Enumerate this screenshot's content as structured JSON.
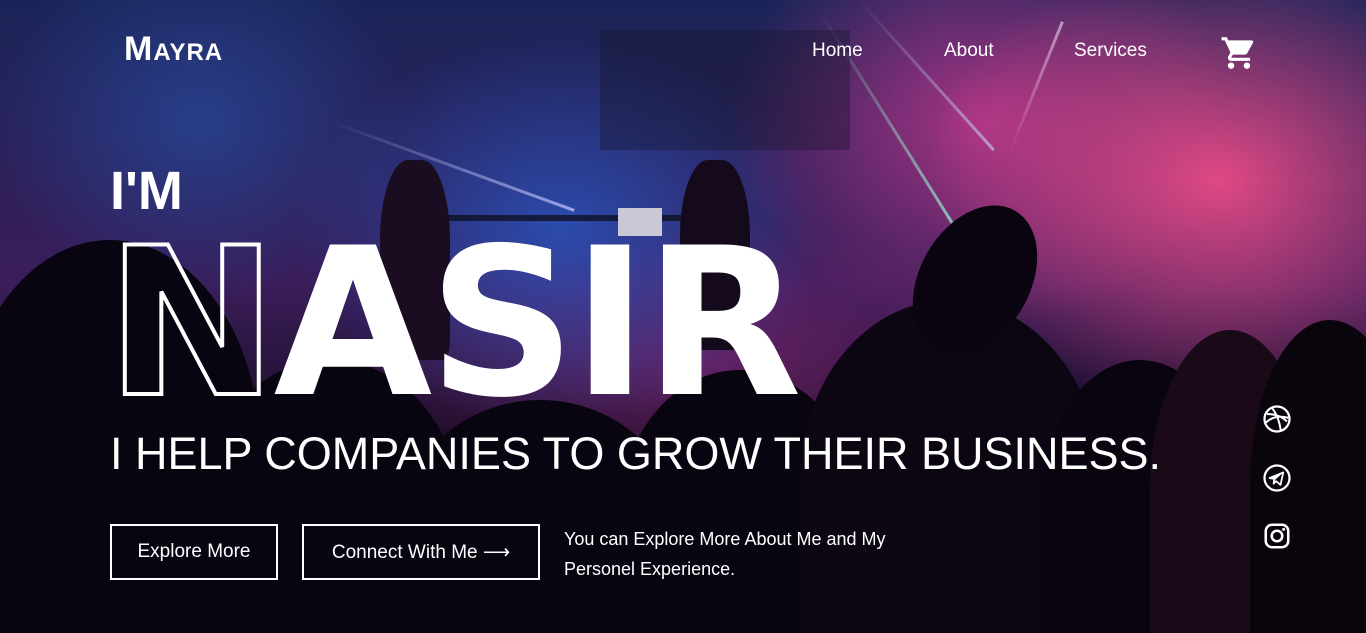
{
  "header": {
    "logo": {
      "first": "M",
      "rest": "AYRA"
    },
    "nav": [
      {
        "label": "Home"
      },
      {
        "label": "About"
      },
      {
        "label": "Services"
      }
    ],
    "cart_icon": "cart-icon"
  },
  "hero": {
    "intro": "I'M",
    "name": {
      "outlined_part": "N",
      "filled_part": "ASIR"
    },
    "tagline": "I HELP COMPANIES TO GROW THEIR BUSINESS.",
    "buttons": {
      "explore": "Explore More",
      "connect": "Connect With Me ⟶"
    },
    "description": "You can Explore More About Me and My Personel Experience."
  },
  "social": [
    {
      "icon": "dribbble-icon"
    },
    {
      "icon": "telegram-icon"
    },
    {
      "icon": "instagram-icon"
    }
  ],
  "colors": {
    "text": "#ffffff",
    "accent_pink": "#ff4f8b",
    "accent_blue": "#2a4fb8"
  }
}
